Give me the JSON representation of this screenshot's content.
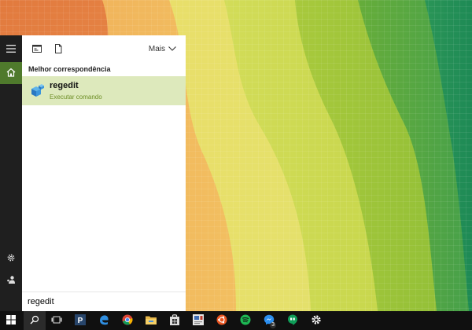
{
  "colors": {
    "accent": "#4f7a2c",
    "result_highlight": "#dde9bc",
    "result_subtitle": "#6e8f27",
    "rail_bg": "#1f1f1f",
    "taskbar_bg": "#101010"
  },
  "rail": {
    "items": [
      {
        "icon": "hamburger-menu-icon"
      },
      {
        "icon": "home-icon"
      },
      {
        "icon": "gear-icon"
      },
      {
        "icon": "feedback-icon"
      }
    ]
  },
  "toolbar": {
    "icons": [
      "apps-icon",
      "documents-icon"
    ],
    "more_label": "Mais",
    "more_icon": "chevron-down-icon"
  },
  "results": {
    "section_title": "Melhor correspondência",
    "best_match": {
      "name": "regedit",
      "type": "Executar comando",
      "icon": "registry-editor-icon"
    }
  },
  "search": {
    "value": "regedit"
  },
  "taskbar": {
    "items": [
      {
        "name": "windows-start-icon"
      },
      {
        "name": "search-icon"
      },
      {
        "name": "task-view-icon"
      },
      {
        "name": "pandora-icon"
      },
      {
        "name": "edge-icon"
      },
      {
        "name": "chrome-icon"
      },
      {
        "name": "file-explorer-icon"
      },
      {
        "name": "store-icon"
      },
      {
        "name": "app-icon"
      },
      {
        "name": "ubuntu-icon"
      },
      {
        "name": "spotify-icon"
      },
      {
        "name": "messenger-icon",
        "badge": "3"
      },
      {
        "name": "hangouts-icon"
      },
      {
        "name": "settings-icon"
      }
    ]
  }
}
